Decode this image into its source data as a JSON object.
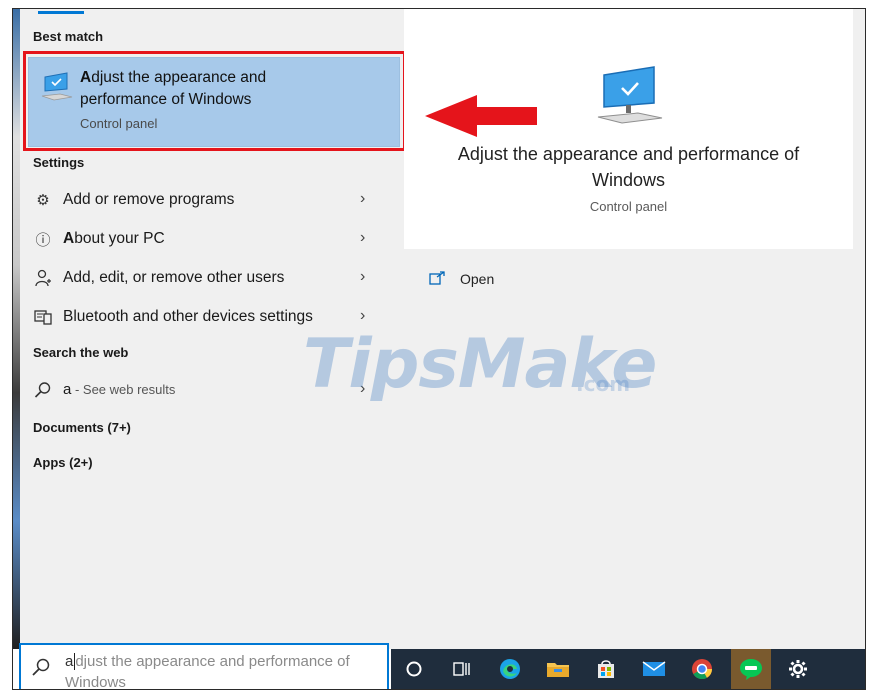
{
  "sections": {
    "best_match": "Best match",
    "settings": "Settings",
    "search_web": "Search the web",
    "documents": "Documents (7+)",
    "apps": "Apps (2+)"
  },
  "best": {
    "title_bold": "A",
    "title_rest": "djust the appearance and performance of Windows",
    "subtitle": "Control panel"
  },
  "settings_items": [
    {
      "icon": "gear-icon",
      "bold": "",
      "label": "Add or remove programs"
    },
    {
      "icon": "info-icon",
      "bold": "A",
      "label": "bout your PC"
    },
    {
      "icon": "person-icon",
      "bold": "",
      "label": "Add, edit, or remove other users"
    },
    {
      "icon": "devices-icon",
      "bold": "",
      "label": "Bluetooth and other devices settings"
    }
  ],
  "web": {
    "query": "a",
    "suffix": " - See web results"
  },
  "detail": {
    "title": "Adjust the appearance and performance of Windows",
    "subtitle": "Control panel",
    "open_label": "Open"
  },
  "search": {
    "typed": "a",
    "placeholder_rest": "djust the appearance and performance of Windows"
  },
  "watermark": {
    "main": "TipsMake",
    "suffix": ".com"
  },
  "colors": {
    "accent": "#0078d4",
    "highlight": "#a7c9ea",
    "annotation": "#e5141b",
    "taskbar": "#1f2d3d"
  }
}
